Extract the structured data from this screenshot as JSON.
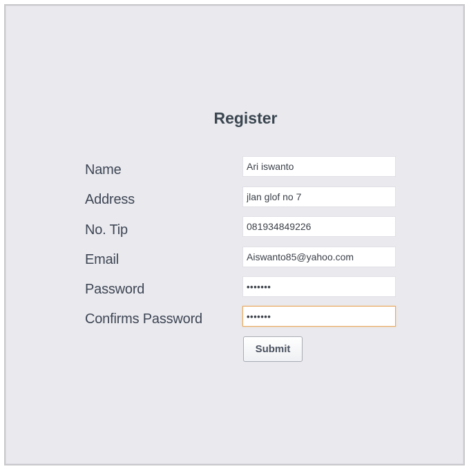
{
  "form": {
    "title": "Register",
    "fields": [
      {
        "label": "Name",
        "value": "Ari iswanto"
      },
      {
        "label": "Address",
        "value": "jlan glof no 7"
      },
      {
        "label": "No. Tip",
        "value": "081934849226"
      },
      {
        "label": "Email",
        "value": "Aiswanto85@yahoo.com"
      },
      {
        "label": "Password",
        "value": "•••••••"
      },
      {
        "label": "Confirms Password",
        "value": "•••••••"
      }
    ],
    "submit_label": "Submit"
  },
  "colors": {
    "panel_background": "#e9e9ee",
    "focus_border": "#e8a95f"
  }
}
